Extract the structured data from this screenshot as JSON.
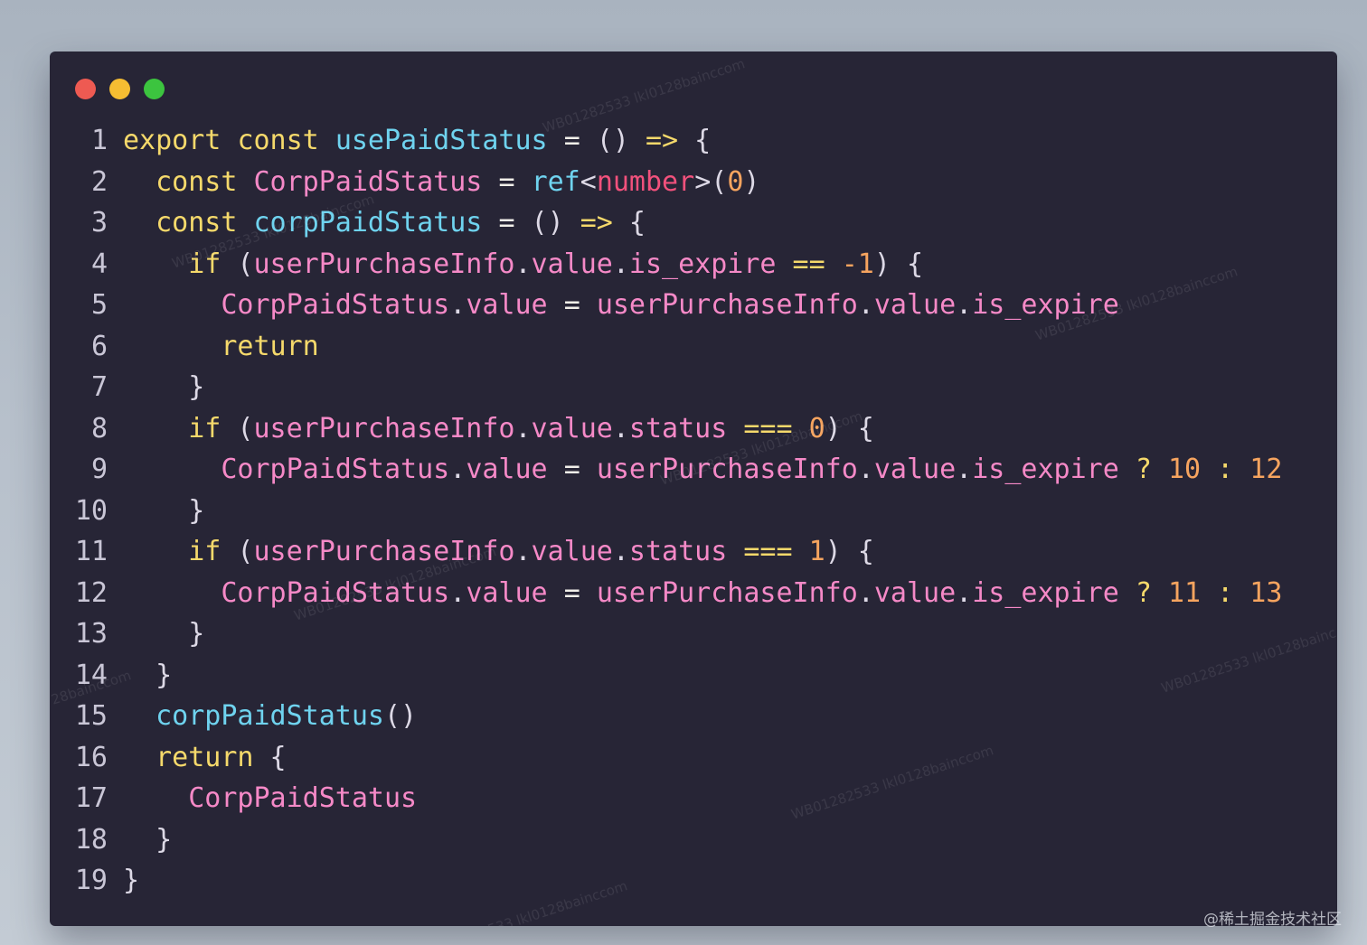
{
  "window": {
    "controls": [
      {
        "name": "close",
        "color": "#ee5a52"
      },
      {
        "name": "minimize",
        "color": "#f5bd32"
      },
      {
        "name": "maximize",
        "color": "#3cc43f"
      }
    ]
  },
  "code": {
    "lines": [
      {
        "n": "1",
        "indent": "",
        "tokens": [
          [
            "kw",
            "export"
          ],
          [
            "p",
            " "
          ],
          [
            "kw",
            "const"
          ],
          [
            "p",
            " "
          ],
          [
            "fn",
            "usePaidStatus"
          ],
          [
            "p",
            " "
          ],
          [
            "op",
            "="
          ],
          [
            "p",
            " () "
          ],
          [
            "kw",
            "=>"
          ],
          [
            "p",
            " {"
          ]
        ]
      },
      {
        "n": "2",
        "indent": "  ",
        "tokens": [
          [
            "kw",
            "const"
          ],
          [
            "p",
            " "
          ],
          [
            "var",
            "CorpPaidStatus"
          ],
          [
            "p",
            " "
          ],
          [
            "op",
            "="
          ],
          [
            "p",
            " "
          ],
          [
            "fn",
            "ref"
          ],
          [
            "p",
            "<"
          ],
          [
            "type",
            "number"
          ],
          [
            "p",
            ">("
          ],
          [
            "num",
            "0"
          ],
          [
            "p",
            ")"
          ]
        ]
      },
      {
        "n": "3",
        "indent": "  ",
        "tokens": [
          [
            "kw",
            "const"
          ],
          [
            "p",
            " "
          ],
          [
            "fn",
            "corpPaidStatus"
          ],
          [
            "p",
            " "
          ],
          [
            "op",
            "="
          ],
          [
            "p",
            " () "
          ],
          [
            "kw",
            "=>"
          ],
          [
            "p",
            " {"
          ]
        ]
      },
      {
        "n": "4",
        "indent": "    ",
        "tokens": [
          [
            "kw",
            "if"
          ],
          [
            "p",
            " ("
          ],
          [
            "var",
            "userPurchaseInfo"
          ],
          [
            "p",
            "."
          ],
          [
            "var",
            "value"
          ],
          [
            "p",
            "."
          ],
          [
            "var",
            "is_expire"
          ],
          [
            "p",
            " "
          ],
          [
            "kw",
            "=="
          ],
          [
            "p",
            " "
          ],
          [
            "num",
            "-1"
          ],
          [
            "p",
            ") {"
          ]
        ]
      },
      {
        "n": "5",
        "indent": "      ",
        "tokens": [
          [
            "var",
            "CorpPaidStatus"
          ],
          [
            "p",
            "."
          ],
          [
            "var",
            "value"
          ],
          [
            "p",
            " "
          ],
          [
            "op",
            "="
          ],
          [
            "p",
            " "
          ],
          [
            "var",
            "userPurchaseInfo"
          ],
          [
            "p",
            "."
          ],
          [
            "var",
            "value"
          ],
          [
            "p",
            "."
          ],
          [
            "var",
            "is_expire"
          ]
        ]
      },
      {
        "n": "6",
        "indent": "      ",
        "tokens": [
          [
            "kw",
            "return"
          ]
        ]
      },
      {
        "n": "7",
        "indent": "    ",
        "tokens": [
          [
            "p",
            "}"
          ]
        ]
      },
      {
        "n": "8",
        "indent": "    ",
        "tokens": [
          [
            "kw",
            "if"
          ],
          [
            "p",
            " ("
          ],
          [
            "var",
            "userPurchaseInfo"
          ],
          [
            "p",
            "."
          ],
          [
            "var",
            "value"
          ],
          [
            "p",
            "."
          ],
          [
            "var",
            "status"
          ],
          [
            "p",
            " "
          ],
          [
            "kw",
            "==="
          ],
          [
            "p",
            " "
          ],
          [
            "num",
            "0"
          ],
          [
            "p",
            ") {"
          ]
        ]
      },
      {
        "n": "9",
        "indent": "      ",
        "tokens": [
          [
            "var",
            "CorpPaidStatus"
          ],
          [
            "p",
            "."
          ],
          [
            "var",
            "value"
          ],
          [
            "p",
            " "
          ],
          [
            "op",
            "="
          ],
          [
            "p",
            " "
          ],
          [
            "var",
            "userPurchaseInfo"
          ],
          [
            "p",
            "."
          ],
          [
            "var",
            "value"
          ],
          [
            "p",
            "."
          ],
          [
            "var",
            "is_expire"
          ],
          [
            "p",
            " "
          ],
          [
            "kw",
            "?"
          ],
          [
            "p",
            " "
          ],
          [
            "num",
            "10"
          ],
          [
            "p",
            " "
          ],
          [
            "kw",
            ":"
          ],
          [
            "p",
            " "
          ],
          [
            "num",
            "12"
          ]
        ]
      },
      {
        "n": "10",
        "indent": "    ",
        "tokens": [
          [
            "p",
            "}"
          ]
        ]
      },
      {
        "n": "11",
        "indent": "    ",
        "tokens": [
          [
            "kw",
            "if"
          ],
          [
            "p",
            " ("
          ],
          [
            "var",
            "userPurchaseInfo"
          ],
          [
            "p",
            "."
          ],
          [
            "var",
            "value"
          ],
          [
            "p",
            "."
          ],
          [
            "var",
            "status"
          ],
          [
            "p",
            " "
          ],
          [
            "kw",
            "==="
          ],
          [
            "p",
            " "
          ],
          [
            "num",
            "1"
          ],
          [
            "p",
            ") {"
          ]
        ]
      },
      {
        "n": "12",
        "indent": "      ",
        "tokens": [
          [
            "var",
            "CorpPaidStatus"
          ],
          [
            "p",
            "."
          ],
          [
            "var",
            "value"
          ],
          [
            "p",
            " "
          ],
          [
            "op",
            "="
          ],
          [
            "p",
            " "
          ],
          [
            "var",
            "userPurchaseInfo"
          ],
          [
            "p",
            "."
          ],
          [
            "var",
            "value"
          ],
          [
            "p",
            "."
          ],
          [
            "var",
            "is_expire"
          ],
          [
            "p",
            " "
          ],
          [
            "kw",
            "?"
          ],
          [
            "p",
            " "
          ],
          [
            "num",
            "11"
          ],
          [
            "p",
            " "
          ],
          [
            "kw",
            ":"
          ],
          [
            "p",
            " "
          ],
          [
            "num",
            "13"
          ]
        ]
      },
      {
        "n": "13",
        "indent": "    ",
        "tokens": [
          [
            "p",
            "}"
          ]
        ]
      },
      {
        "n": "14",
        "indent": "  ",
        "tokens": [
          [
            "p",
            "}"
          ]
        ]
      },
      {
        "n": "15",
        "indent": "  ",
        "tokens": [
          [
            "fn",
            "corpPaidStatus"
          ],
          [
            "p",
            "()"
          ]
        ]
      },
      {
        "n": "16",
        "indent": "  ",
        "tokens": [
          [
            "kw",
            "return"
          ],
          [
            "p",
            " {"
          ]
        ]
      },
      {
        "n": "17",
        "indent": "    ",
        "tokens": [
          [
            "var",
            "CorpPaidStatus"
          ]
        ]
      },
      {
        "n": "18",
        "indent": "  ",
        "tokens": [
          [
            "p",
            "}"
          ]
        ]
      },
      {
        "n": "19",
        "indent": "",
        "tokens": [
          [
            "p",
            "}"
          ]
        ]
      }
    ]
  },
  "colors": {
    "background": "#272536",
    "keyword": "#f5d96b",
    "function": "#6fd3ef",
    "variable": "#f589c7",
    "number": "#f6a45f",
    "type": "#f2517c"
  },
  "watermarks": [
    "WB01282533 lkl0128baincсom",
    "WB01282533 lkl0128baincсom",
    "WB01282533 lkl0128baincсom",
    "WB01282533 lkl0128baincсom",
    "WB01282533 lkl0128baincсom",
    "WB01282533 lkl0128bainc",
    "WB01282533 lkl0128baincсom",
    "28bainccom"
  ],
  "footer": {
    "attribution": "@稀土掘金技术社区"
  }
}
